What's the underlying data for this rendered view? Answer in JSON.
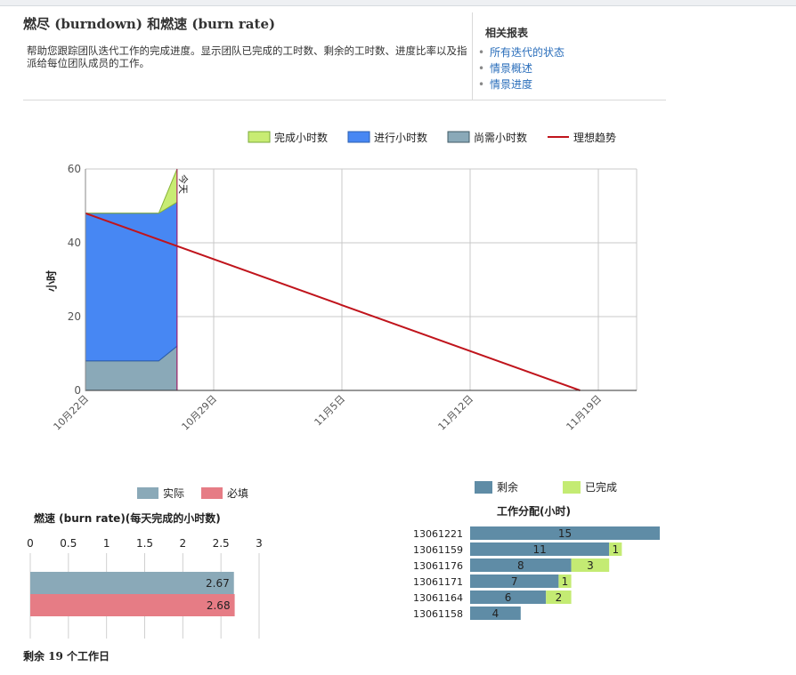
{
  "header": {
    "title": "燃尽 (burndown) 和燃速 (burn rate)",
    "description": "帮助您跟踪团队迭代工作的完成进度。显示团队已完成的工时数、剩余的工时数、进度比率以及指派给每位团队成员的工作。"
  },
  "related": {
    "title": "相关报表",
    "items": [
      {
        "label": "所有迭代的状态"
      },
      {
        "label": "情景概述"
      },
      {
        "label": "情景进度"
      }
    ]
  },
  "colors": {
    "completed": "#c8ec73",
    "in_progress": "#4787f3",
    "needed": "#8aa9b8",
    "ideal": "#c0141c",
    "actual": "#8aa9b8",
    "required": "#e67c85",
    "remaining": "#5f8ca6",
    "done": "#c4eb73",
    "link": "#2a6ebb"
  },
  "chart_data": [
    {
      "type": "area",
      "ylabel": "小时",
      "ylim": [
        0,
        60
      ],
      "yticks": [
        0,
        20,
        40,
        60
      ],
      "xlim": [
        0,
        27
      ],
      "xticks": [
        {
          "x": 0,
          "label": "10月22日"
        },
        {
          "x": 7,
          "label": "10月29日"
        },
        {
          "x": 14,
          "label": "11月5日"
        },
        {
          "x": 21,
          "label": "11月12日"
        },
        {
          "x": 28,
          "label": "11月19日"
        }
      ],
      "legend": [
        "完成小时数",
        "进行小时数",
        "尚需小时数",
        "理想趋势"
      ],
      "legend_position": "top-right",
      "today_marker": {
        "x": 5,
        "label": "今天"
      },
      "series": [
        {
          "name": "尚需小时数",
          "x": [
            0,
            4,
            5
          ],
          "values": [
            8,
            8,
            12
          ]
        },
        {
          "name": "进行小时数",
          "x": [
            0,
            4,
            5
          ],
          "values": [
            40,
            40,
            39
          ]
        },
        {
          "name": "完成小时数",
          "x": [
            0,
            4,
            5
          ],
          "values": [
            0,
            0,
            9
          ]
        },
        {
          "name": "理想趋势",
          "x": [
            0,
            27
          ],
          "values": [
            48,
            0
          ]
        }
      ]
    },
    {
      "type": "bar",
      "orientation": "horizontal",
      "title": "燃速 (burn rate)(每天完成的小时数)",
      "xlim": [
        0,
        3
      ],
      "xticks": [
        "0",
        "0.5",
        "1",
        "1.5",
        "2",
        "2.5",
        "3"
      ],
      "legend": [
        "实际",
        "必填"
      ],
      "legend_position": "top",
      "series": [
        {
          "name": "实际",
          "values": [
            2.67
          ],
          "label": "2.67"
        },
        {
          "name": "必填",
          "values": [
            2.68
          ],
          "label": "2.68"
        }
      ]
    },
    {
      "type": "bar",
      "orientation": "horizontal",
      "stacked": true,
      "title": "工作分配(小时)",
      "legend": [
        "剩余",
        "已完成"
      ],
      "legend_position": "top",
      "categories": [
        "13061221",
        "13061159",
        "13061176",
        "13061171",
        "13061164",
        "13061158"
      ],
      "series": [
        {
          "name": "剩余",
          "values": [
            15,
            11,
            8,
            7,
            6,
            4
          ]
        },
        {
          "name": "已完成",
          "values": [
            0,
            1,
            3,
            1,
            2,
            0
          ]
        }
      ]
    }
  ],
  "footer": {
    "remaining_text": "剩余 19 个工作日"
  }
}
